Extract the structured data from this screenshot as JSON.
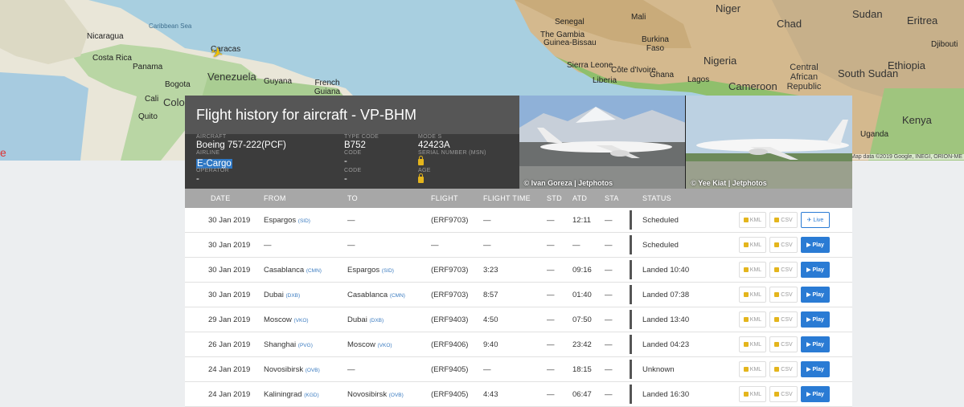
{
  "map": {
    "labels": {
      "caribbean_sea": "Caribbean Sea",
      "nicaragua": "Nicaragua",
      "costa_rica": "Costa Rica",
      "panama": "Panama",
      "caracas": "Caracas",
      "venezuela": "Venezuela",
      "guyana": "Guyana",
      "bogota": "Bogota",
      "cali": "Cali",
      "colombia": "Colom",
      "quito": "Quito",
      "french_guiana": "French Guiana",
      "senegal": "Senegal",
      "the_gambia": "The Gambia",
      "guinea_bissau": "Guinea-Bissau",
      "sierra_leone": "Sierra Leone",
      "liberia": "Liberia",
      "cote_divoire": "Côte d'Ivoire",
      "niger": "Niger",
      "chad": "Chad",
      "sudan": "Sudan",
      "eritrea": "Eritrea",
      "djibouti": "Djibouti",
      "burkina_faso": "Burkina Faso",
      "ghana": "Ghana",
      "nigeria": "Nigeria",
      "lagos": "Lagos",
      "cameroon": "Cameroon",
      "car": "Central African Republic",
      "south_sudan": "South Sudan",
      "ethiopia": "Ethiopia",
      "kenya": "Kenya",
      "uganda": "Uganda",
      "mali": "Mali"
    },
    "attribution": "Map data ©2019 Google, INEGI, ORION-ME"
  },
  "aircraft": {
    "title": "Flight history for aircraft - VP-BHM",
    "fields": {
      "aircraft_label": "AIRCRAFT",
      "aircraft_value": "Boeing 757-222(PCF)",
      "airline_label": "AIRLINE",
      "airline_value": "E-Cargo",
      "operator_label": "OPERATOR",
      "operator_value": "-",
      "type_code_label": "TYPE CODE",
      "type_code_value": "B752",
      "code_label": "Code",
      "code_value": "-",
      "code2_label": "Code",
      "code2_value": "-",
      "mode_s_label": "MODE S",
      "mode_s_value": "42423A",
      "serial_label": "SERIAL NUMBER (MSN)",
      "age_label": "AGE"
    },
    "photos": [
      {
        "credit": "© Ivan Goreza | Jetphotos"
      },
      {
        "credit": "© Yee Kiat | Jetphotos"
      }
    ]
  },
  "table": {
    "headers": {
      "date": "DATE",
      "from": "FROM",
      "to": "TO",
      "flight": "FLIGHT",
      "flight_time": "FLIGHT TIME",
      "std": "STD",
      "atd": "ATD",
      "sta": "STA",
      "status": "STATUS"
    },
    "buttons": {
      "kml": "KML",
      "csv": "CSV",
      "play": "▶ Play",
      "live": "✈ Live"
    },
    "rows": [
      {
        "date": "30 Jan 2019",
        "from": "Espargos",
        "from_code": "(SID)",
        "to": "—",
        "to_code": "",
        "flight": "(ERF9703)",
        "time": "—",
        "std": "—",
        "atd": "12:11",
        "sta": "—",
        "status": "Scheduled",
        "action": "live"
      },
      {
        "date": "30 Jan 2019",
        "from": "—",
        "from_code": "",
        "to": "—",
        "to_code": "",
        "flight": "—",
        "time": "—",
        "std": "—",
        "atd": "—",
        "sta": "—",
        "status": "Scheduled",
        "action": "play"
      },
      {
        "date": "30 Jan 2019",
        "from": "Casablanca",
        "from_code": "(CMN)",
        "to": "Espargos",
        "to_code": "(SID)",
        "flight": "(ERF9703)",
        "time": "3:23",
        "std": "—",
        "atd": "09:16",
        "sta": "—",
        "status": "Landed 10:40",
        "action": "play"
      },
      {
        "date": "30 Jan 2019",
        "from": "Dubai",
        "from_code": "(DXB)",
        "to": "Casablanca",
        "to_code": "(CMN)",
        "flight": "(ERF9703)",
        "time": "8:57",
        "std": "—",
        "atd": "01:40",
        "sta": "—",
        "status": "Landed 07:38",
        "action": "play"
      },
      {
        "date": "29 Jan 2019",
        "from": "Moscow",
        "from_code": "(VKO)",
        "to": "Dubai",
        "to_code": "(DXB)",
        "flight": "(ERF9403)",
        "time": "4:50",
        "std": "—",
        "atd": "07:50",
        "sta": "—",
        "status": "Landed 13:40",
        "action": "play"
      },
      {
        "date": "26 Jan 2019",
        "from": "Shanghai",
        "from_code": "(PVG)",
        "to": "Moscow",
        "to_code": "(VKO)",
        "flight": "(ERF9406)",
        "time": "9:40",
        "std": "—",
        "atd": "23:42",
        "sta": "—",
        "status": "Landed 04:23",
        "action": "play"
      },
      {
        "date": "24 Jan 2019",
        "from": "Novosibirsk",
        "from_code": "(OVB)",
        "to": "—",
        "to_code": "",
        "flight": "(ERF9405)",
        "time": "—",
        "std": "—",
        "atd": "18:15",
        "sta": "—",
        "status": "Unknown",
        "action": "play"
      },
      {
        "date": "24 Jan 2019",
        "from": "Kaliningrad",
        "from_code": "(KGD)",
        "to": "Novosibirsk",
        "to_code": "(OVB)",
        "flight": "(ERF9405)",
        "time": "4:43",
        "std": "—",
        "atd": "06:47",
        "sta": "—",
        "status": "Landed 16:30",
        "action": "play"
      }
    ]
  }
}
